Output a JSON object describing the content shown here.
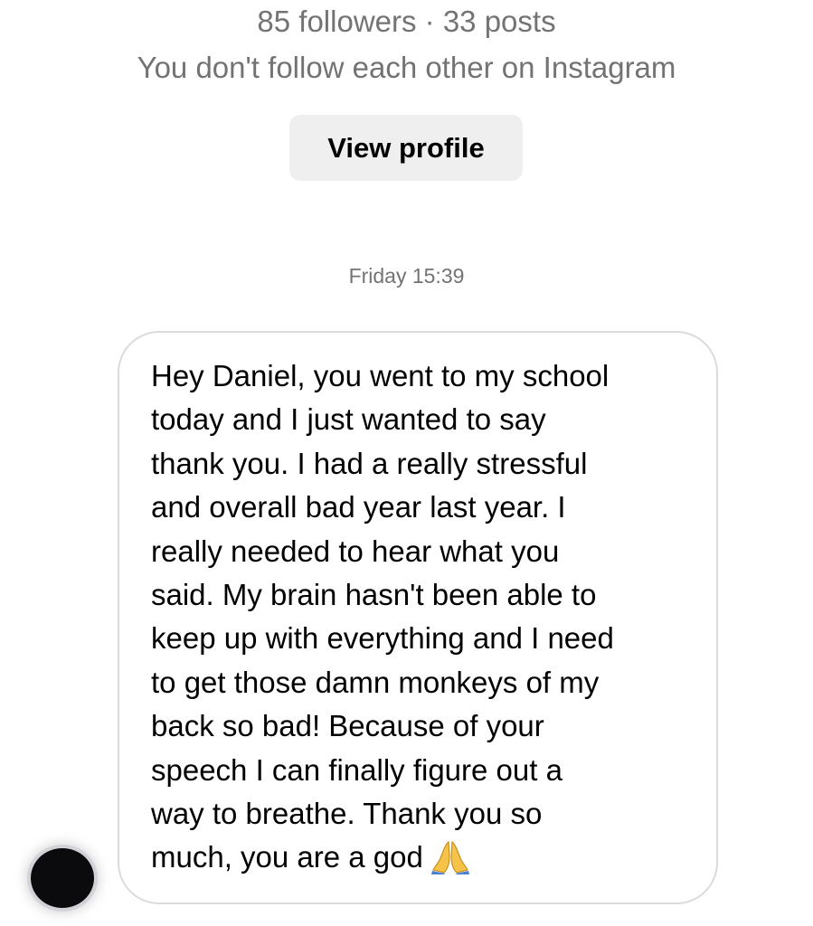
{
  "profile": {
    "stats": "85 followers · 33 posts",
    "relationship": "You don't follow each other on Instagram",
    "view_profile_label": "View profile"
  },
  "thread": {
    "timestamp": "Friday 15:39",
    "messages": [
      {
        "sender": "other",
        "text": "Hey Daniel, you went to my school\ntoday and I just wanted to say\nthank you. I had a really stressful\nand overall bad year last year. I\nreally needed to hear what you\nsaid. My brain hasn't been able to\nkeep up with everything and I need\nto get those damn monkeys of my\nback so bad! Because of your\nspeech I can finally figure out a\nway to breathe. Thank you so\nmuch, you are a god",
        "emoji": "folded-hands-icon"
      }
    ]
  },
  "colors": {
    "secondary_text": "#737373",
    "button_background": "#efefef",
    "bubble_border": "#dbdbdb",
    "emoji_yellow": "#f5c24a"
  }
}
